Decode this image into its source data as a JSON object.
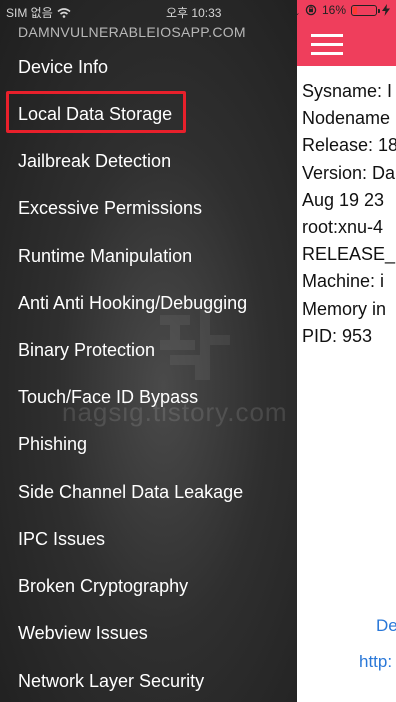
{
  "status": {
    "carrier": "SIM 없음",
    "time": "오후 10:33",
    "battery": "16%",
    "battery_level": 0.16
  },
  "drawer": {
    "app_name": "DAMNVULNERABLEIOSAPP.COM",
    "items": [
      {
        "label": "Device Info"
      },
      {
        "label": "Local Data Storage",
        "selected": true
      },
      {
        "label": "Jailbreak Detection"
      },
      {
        "label": "Excessive Permissions"
      },
      {
        "label": "Runtime Manipulation"
      },
      {
        "label": "Anti Anti Hooking/Debugging"
      },
      {
        "label": "Binary Protection"
      },
      {
        "label": "Touch/Face ID Bypass"
      },
      {
        "label": "Phishing"
      },
      {
        "label": "Side Channel Data Leakage"
      },
      {
        "label": "IPC Issues"
      },
      {
        "label": "Broken Cryptography"
      },
      {
        "label": "Webview Issues"
      },
      {
        "label": "Network Layer Security"
      }
    ],
    "watermark": "nagsig.tistory.com"
  },
  "content": {
    "info_lines": [
      "Sysname: I",
      "Nodename",
      "Release: 18",
      "Version: Da",
      "Aug 19 23",
      "root:xnu-4",
      "RELEASE_",
      "Machine: i",
      "Memory in",
      "PID: 953"
    ],
    "link1": "De",
    "link2": "http:"
  },
  "colors": {
    "accent": "#ef3e5c",
    "selection_border": "#e8202b",
    "link": "#2a78d8",
    "drawer_bg": "#2f2f2f"
  }
}
